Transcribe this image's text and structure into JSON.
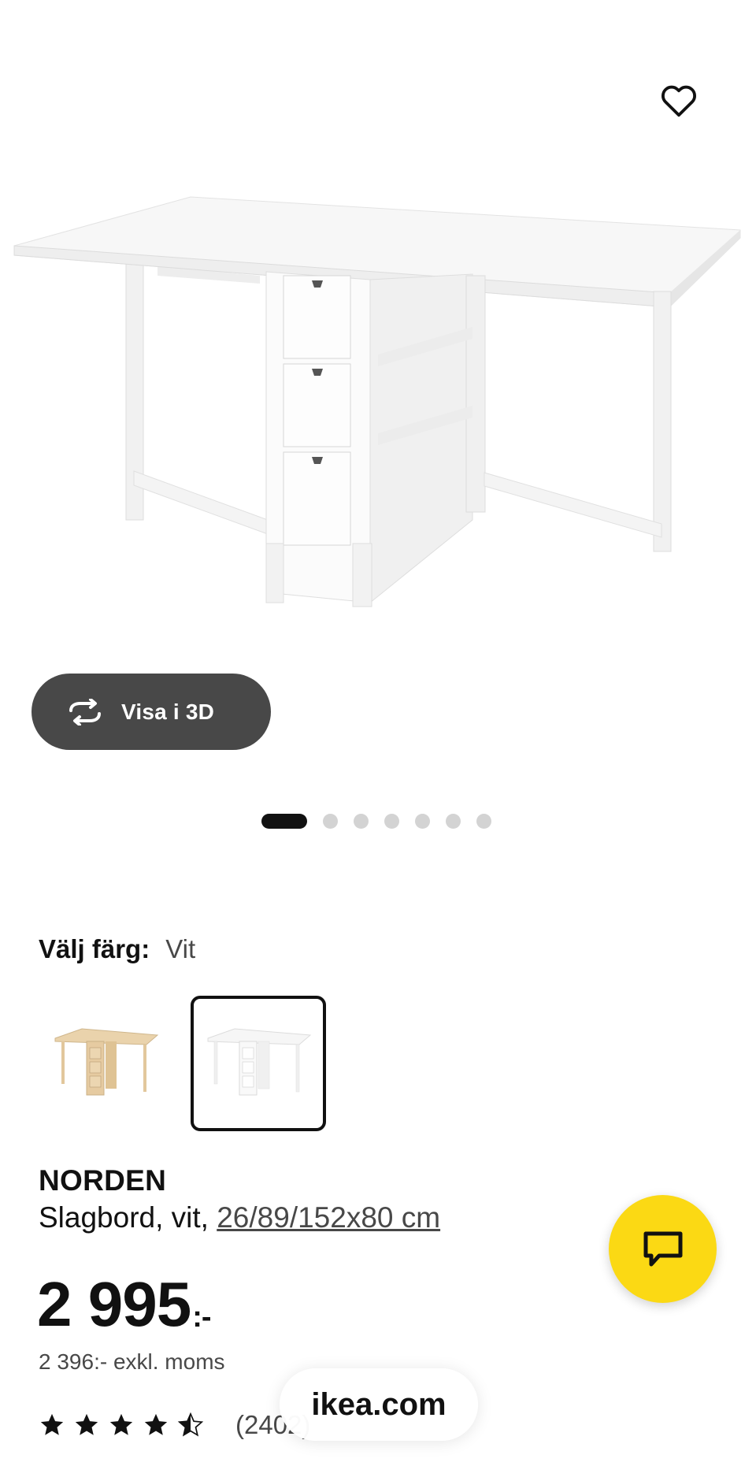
{
  "hero": {
    "favorite_icon": "heart-outline-icon",
    "view_3d": {
      "icon": "rotate-icon",
      "label": "Visa i 3D"
    },
    "carousel": {
      "count": 7,
      "active_index": 0
    }
  },
  "variant": {
    "label": "Välj färg:",
    "value": "Vit",
    "options": [
      {
        "name": "björk",
        "color": "#e8cfa6",
        "selected": false
      },
      {
        "name": "vit",
        "color": "#f3f3f3",
        "selected": true
      }
    ]
  },
  "product": {
    "name": "NORDEN",
    "description": "Slagbord, vit,",
    "dimensions": "26/89/152x80 cm",
    "price": "2 995",
    "price_suffix": ":-",
    "price_excl_vat": "2 396:- exkl. moms",
    "rating": {
      "value": 4.5,
      "max": 5,
      "count_text": "(2402)"
    }
  },
  "chat": {
    "icon": "chat-bubble-icon",
    "color": "#fbd914"
  },
  "browser": {
    "url": "ikea.com"
  }
}
